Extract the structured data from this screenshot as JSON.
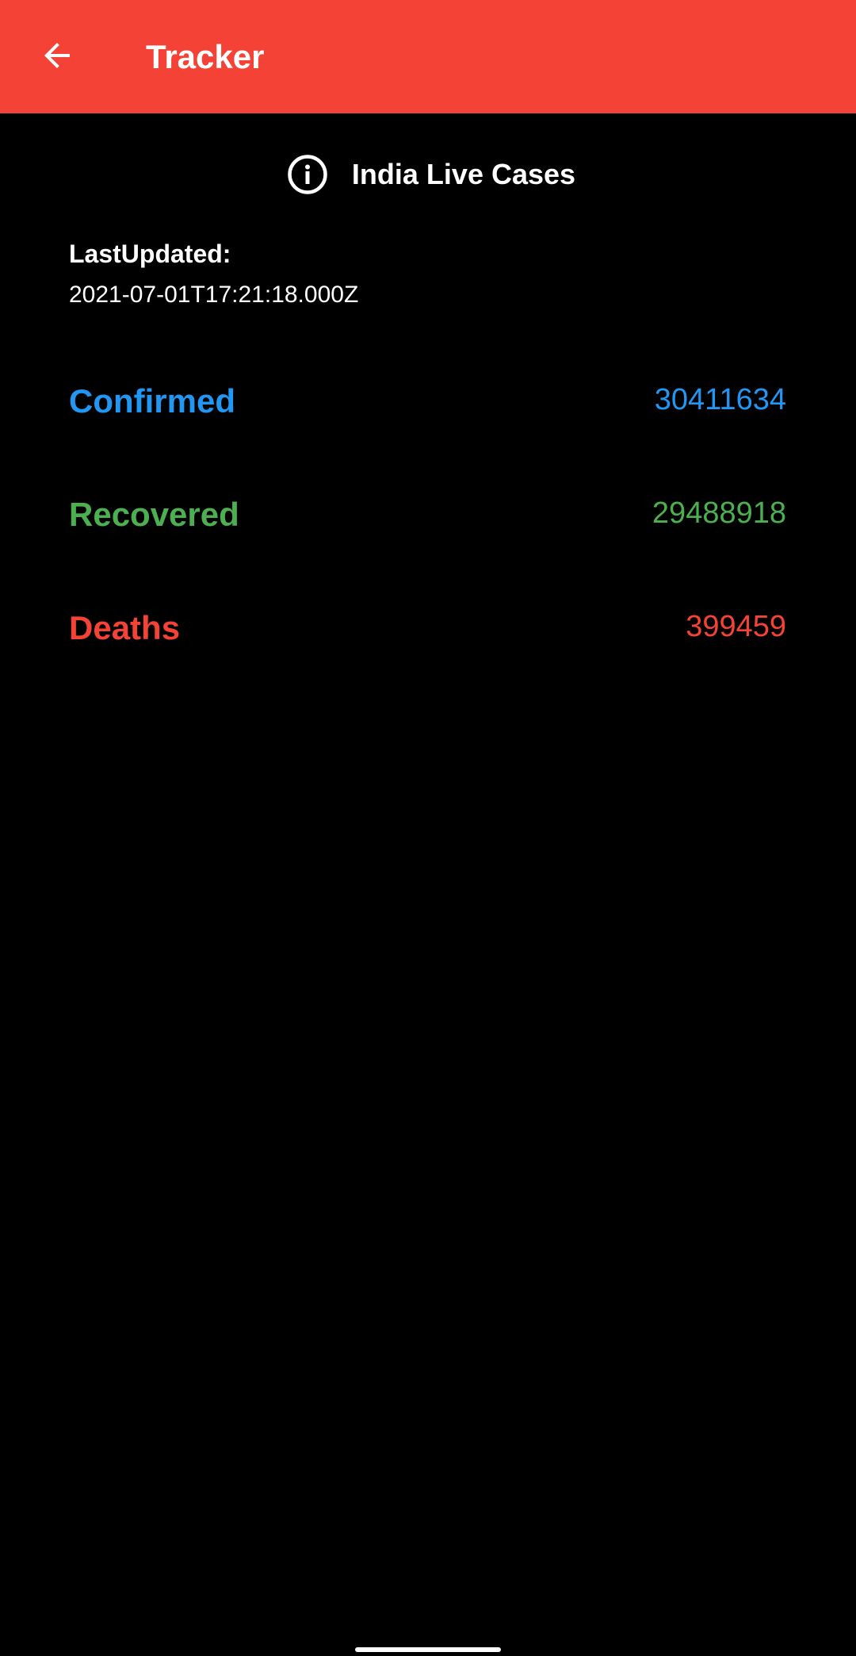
{
  "app_bar": {
    "title": "Tracker",
    "back_icon": "arrow-left-icon",
    "background_color": "#f44336"
  },
  "header": {
    "icon": "info-icon",
    "title": "India Live Cases"
  },
  "last_updated": {
    "label": "LastUpdated:",
    "value": "2021-07-01T17:21:18.000Z"
  },
  "stats": [
    {
      "label": "Confirmed",
      "value": "30411634",
      "color": "#2196f3"
    },
    {
      "label": "Recovered",
      "value": "29488918",
      "color": "#4caf50"
    },
    {
      "label": "Deaths",
      "value": "399459",
      "color": "#f44336"
    }
  ]
}
